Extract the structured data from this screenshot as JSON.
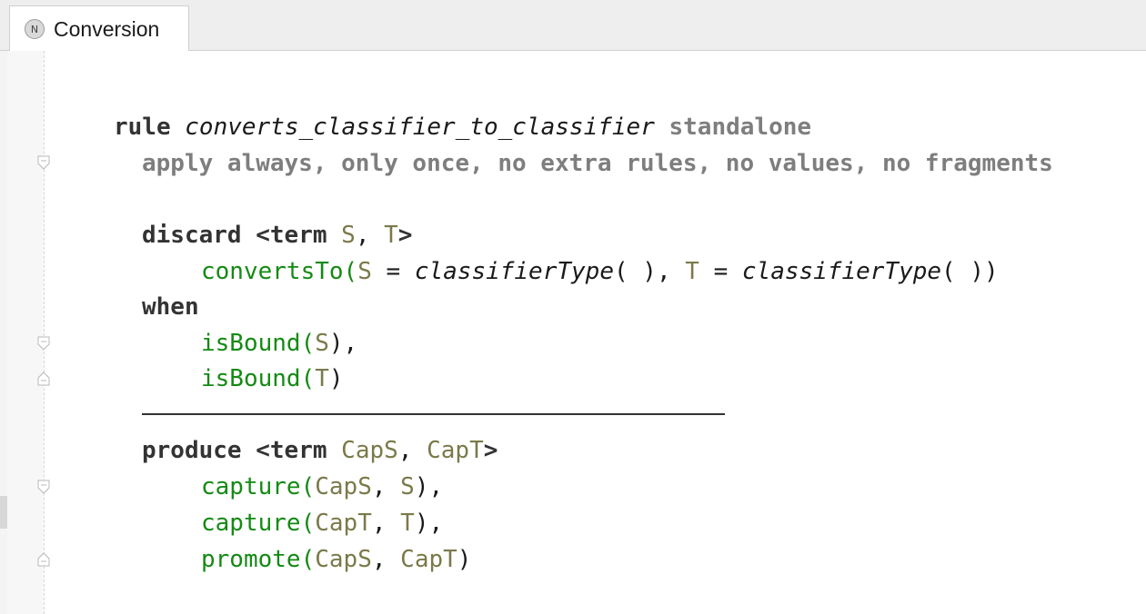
{
  "tab": {
    "icon_letter": "N",
    "label": "Conversion"
  },
  "code": {
    "rule_kw": "rule",
    "rule_name": "converts_classifier_to_classifier",
    "standalone_kw": "standalone",
    "options": "apply always, only once, no extra rules, no values, no fragments",
    "discard_kw": "discard",
    "term_kw": "<term",
    "discard_var1": "S",
    "discard_sep": ", ",
    "discard_var2": "T",
    "close_angle": ">",
    "converts_fn": "convertsTo",
    "converts_open": "(",
    "converts_var1": "S",
    "eq1": " = ",
    "classifier_call1": "classifierType",
    "call_parens1": "( ), ",
    "converts_var2": "T",
    "eq2": " = ",
    "classifier_call2": "classifierType",
    "call_parens2": "( ))",
    "when_kw": "when",
    "isbound_fn1": "isBound",
    "isbound1_open": "(",
    "isbound1_var": "S",
    "isbound1_close": "),",
    "isbound_fn2": "isBound",
    "isbound2_open": "(",
    "isbound2_var": "T",
    "isbound2_close": ")",
    "produce_kw": "produce",
    "produce_term_kw": "<term",
    "produce_var1": "CapS",
    "produce_sep": ", ",
    "produce_var2": "CapT",
    "produce_close": ">",
    "capture_fn1": "capture",
    "capture1_open": "(",
    "capture1_arg1": "CapS",
    "capture1_sep": ", ",
    "capture1_arg2": "S",
    "capture1_close": "),",
    "capture_fn2": "capture",
    "capture2_open": "(",
    "capture2_arg1": "CapT",
    "capture2_sep": ", ",
    "capture2_arg2": "T",
    "capture2_close": "),",
    "promote_fn": "promote",
    "promote_open": "(",
    "promote_arg1": "CapS",
    "promote_sep": ", ",
    "promote_arg2": "CapT",
    "promote_close": ")"
  },
  "colors": {
    "keyword": "#333333",
    "option": "#7e7e7e",
    "variable": "#7a7a4a",
    "function": "#148a14"
  }
}
